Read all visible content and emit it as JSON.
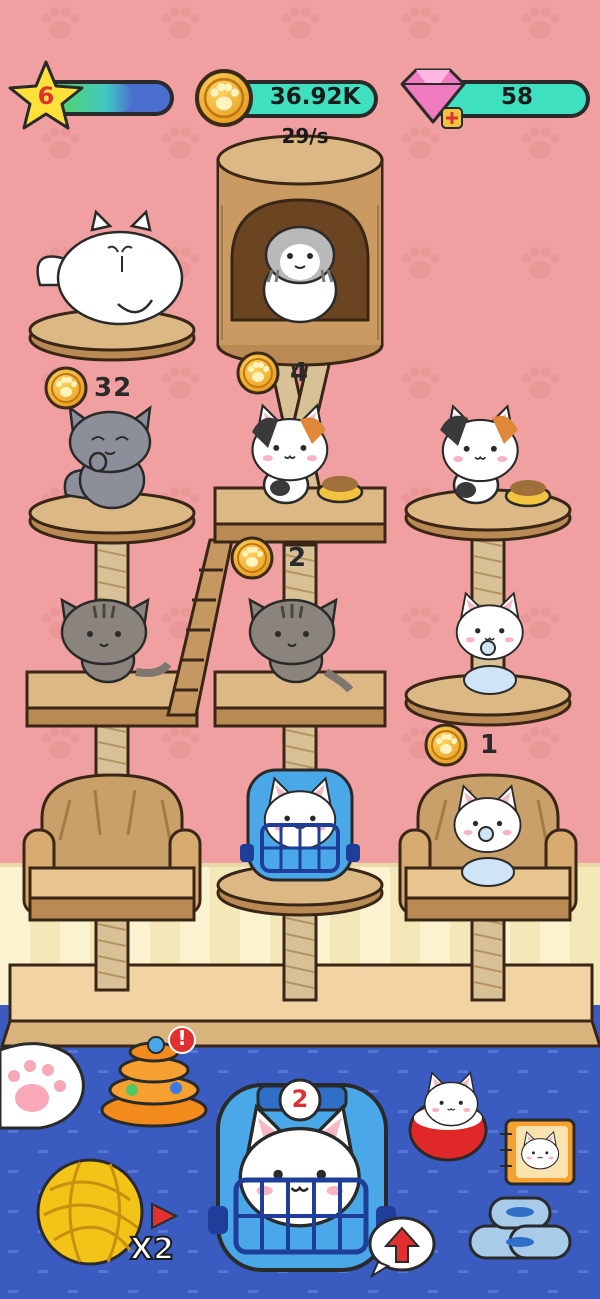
{
  "hud": {
    "level": "6",
    "level_progress": 0.72,
    "coins": "36.92K",
    "rate": "29/s",
    "gems": "58"
  },
  "earnings": [
    {
      "id": "left-top",
      "amount": "32"
    },
    {
      "id": "center-top",
      "amount": "4"
    },
    {
      "id": "center-mid",
      "amount": "2"
    },
    {
      "id": "right-mid",
      "amount": "1"
    }
  ],
  "toolbar": {
    "yarn_multiplier": "x2",
    "carrier_count": "2",
    "toy_alert": "!"
  },
  "cats": [
    {
      "id": "white-fluffy",
      "breed": "white persian"
    },
    {
      "id": "gray-tabby-house",
      "breed": "gray tabby"
    },
    {
      "id": "gray-cat",
      "breed": "gray"
    },
    {
      "id": "calico-center",
      "breed": "calico"
    },
    {
      "id": "calico-right",
      "breed": "calico"
    },
    {
      "id": "tabby-left",
      "breed": "gray tabby"
    },
    {
      "id": "tabby-center",
      "breed": "gray tabby"
    },
    {
      "id": "kitten-right-upper",
      "breed": "white kitten"
    },
    {
      "id": "kitten-right-lower",
      "breed": "white kitten"
    }
  ],
  "colors": {
    "wall": "#f0a0a0",
    "floor": "#3a5cc0",
    "wood": "#d6b07a",
    "teal_bar": "#3ee0c0",
    "star": "#ffe13a",
    "coin": "#f0b030"
  }
}
